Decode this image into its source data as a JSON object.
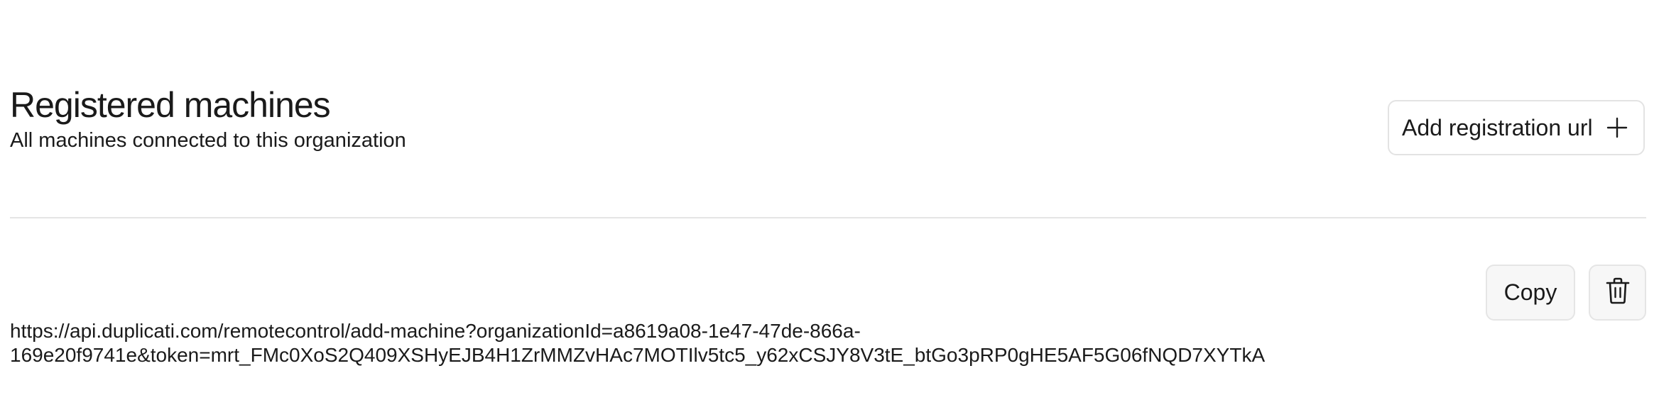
{
  "header": {
    "title": "Registered machines",
    "subtitle": "All machines connected to this organization"
  },
  "actions": {
    "add_label": "Add registration url",
    "add_icon": "plus-icon"
  },
  "registration": {
    "url_line1": "https://api.duplicati.com/remotecontrol/add-machine?organizationId=a8619a08-1e47-47de-866a-",
    "url_line2": "169e20f9741e&token=mrt_FMc0XoS2Q409XSHyEJB4H1ZrMMZvHAc7MOTIlv5tc5_y62xCSJY8V3tE_btGo3pRP0gHE5AF5G06fNQD7XYTkA",
    "copy_label": "Copy",
    "delete_icon": "trash-icon"
  },
  "colors": {
    "border": "#e3e3e3",
    "button_bg": "#f7f7f7",
    "text": "#1a1a1a",
    "divider": "#e5e5e5"
  }
}
